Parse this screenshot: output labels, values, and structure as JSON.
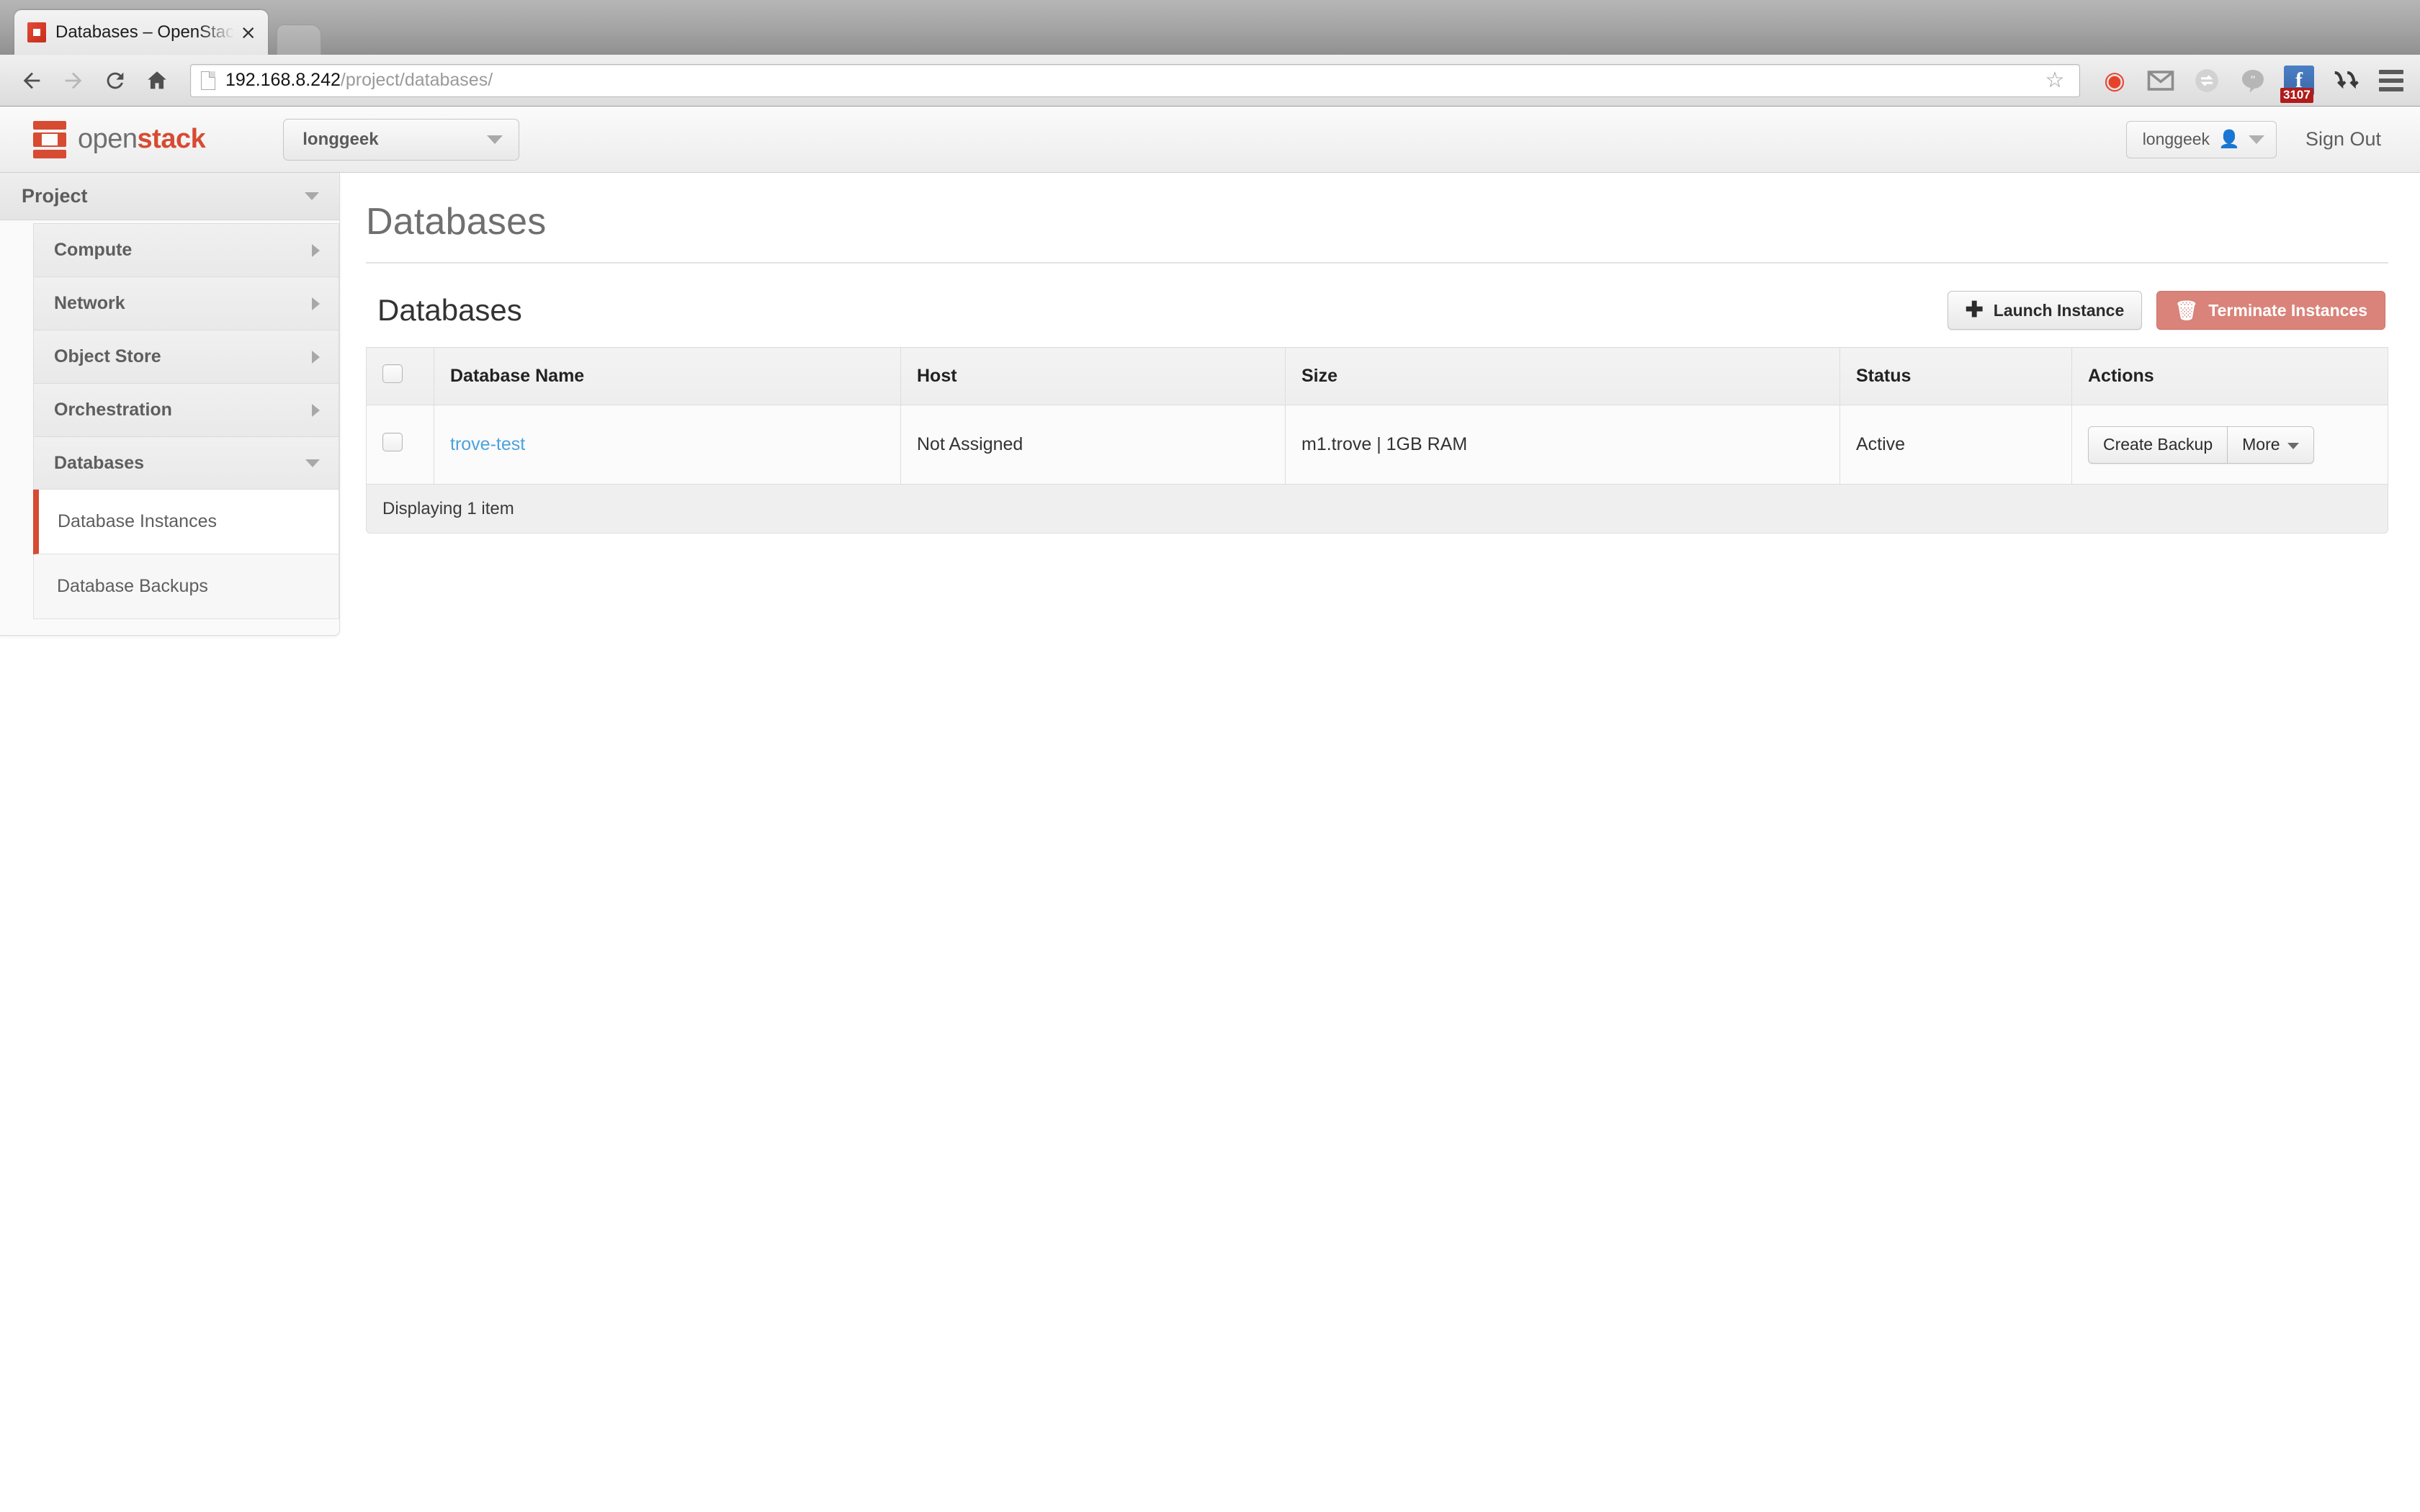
{
  "browser": {
    "tab_title": "Databases – OpenStack Da",
    "close_label": "×",
    "url_host": "192.168.8.242",
    "url_path": "/project/databases/",
    "back_icon": "back-arrow-icon",
    "forward_icon": "forward-arrow-icon",
    "reload_icon": "reload-icon",
    "home_icon": "home-icon",
    "star_icon": "☆",
    "extensions": [
      {
        "name": "weibo-extension-icon",
        "glyph": "◉"
      },
      {
        "name": "gmail-extension-icon",
        "glyph": "M"
      },
      {
        "name": "globe-sync-extension-icon",
        "glyph": "◌"
      },
      {
        "name": "hangouts-extension-icon",
        "glyph": "”"
      },
      {
        "name": "facebook-extension-icon",
        "glyph": "f",
        "badge": "3107"
      },
      {
        "name": "download-arrows-extension-icon",
        "glyph": "⤵"
      }
    ]
  },
  "header": {
    "logo_open": "open",
    "logo_stack": "stack",
    "project_selector": "longgeek",
    "user_menu": "longgeek",
    "sign_out": "Sign Out"
  },
  "sidebar": {
    "section_title": "Project",
    "items": [
      {
        "label": "Compute",
        "expanded": false
      },
      {
        "label": "Network",
        "expanded": false
      },
      {
        "label": "Object Store",
        "expanded": false
      },
      {
        "label": "Orchestration",
        "expanded": false
      },
      {
        "label": "Databases",
        "expanded": true
      }
    ],
    "subitems": [
      {
        "label": "Database Instances",
        "active": true
      },
      {
        "label": "Database Backups",
        "active": false
      }
    ]
  },
  "main": {
    "page_title": "Databases",
    "table_title": "Databases",
    "launch_button": "Launch Instance",
    "terminate_button": "Terminate Instances",
    "columns": [
      "Database Name",
      "Host",
      "Size",
      "Status",
      "Actions"
    ],
    "rows": [
      {
        "name": "trove-test",
        "host": "Not Assigned",
        "size": "m1.trove | 1GB RAM",
        "status": "Active",
        "action_primary": "Create Backup",
        "action_more": "More"
      }
    ],
    "footer": "Displaying 1 item"
  },
  "colors": {
    "accent_red": "#d64b32",
    "danger": "#d9837a",
    "link_blue": "#4ba3dd"
  }
}
